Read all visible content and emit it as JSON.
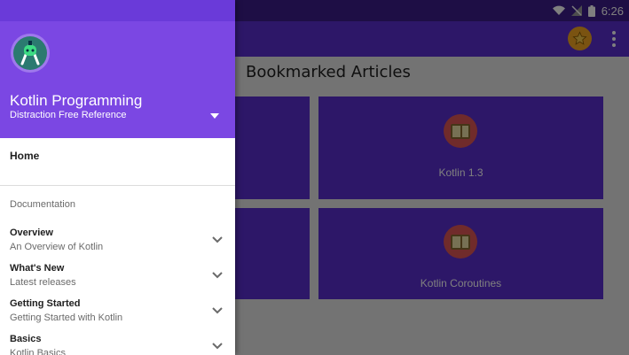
{
  "status_bar": {
    "time": "6:26",
    "icons": [
      "wifi-icon",
      "no-signal-icon",
      "battery-icon"
    ]
  },
  "app_bar": {
    "actions": [
      "star-icon",
      "more-vert-icon"
    ]
  },
  "content": {
    "title": "Bookmarked Articles",
    "cards": [
      {
        "label": "Kotlin 1.3",
        "icon": "book-icon"
      },
      {
        "label": "Kotlin Coroutines",
        "icon": "book-icon"
      }
    ]
  },
  "drawer": {
    "header": {
      "title": "Kotlin Programming",
      "subtitle": "Distraction Free Reference",
      "logo": "android-studio-icon"
    },
    "home_label": "Home",
    "section_header": "Documentation",
    "items": [
      {
        "title": "Overview",
        "subtitle": "An Overview of Kotlin"
      },
      {
        "title": "What's New",
        "subtitle": "Latest releases"
      },
      {
        "title": "Getting Started",
        "subtitle": "Getting Started with Kotlin"
      },
      {
        "title": "Basics",
        "subtitle": "Kotlin Basics"
      }
    ]
  },
  "colors": {
    "primary": "#5a2ed1",
    "primary_dark": "#3d1d8a",
    "drawer_header": "#7b47e3",
    "accent": "#f5a623"
  }
}
